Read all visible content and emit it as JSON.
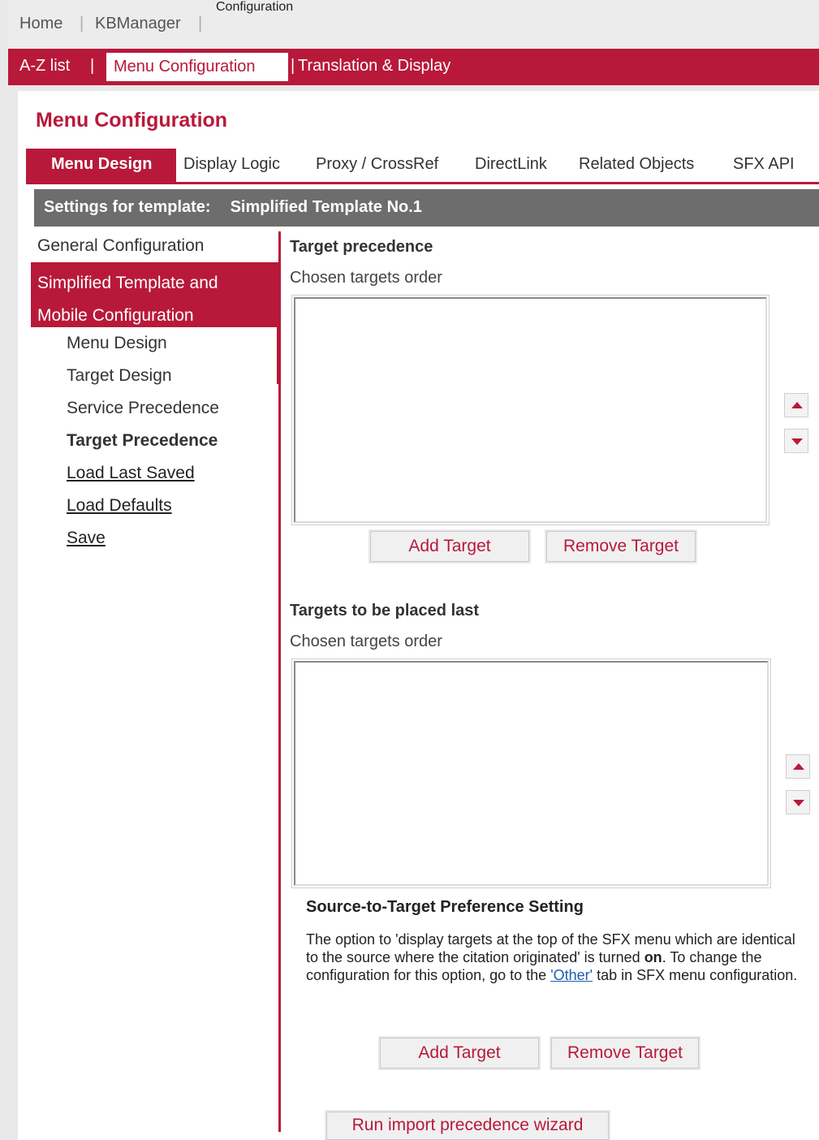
{
  "topnav": {
    "home": "Home",
    "kbmanager": "KBManager",
    "configuration": "Configuration"
  },
  "subnav": {
    "az_list": "A-Z list",
    "menu_configuration": "Menu Configuration",
    "translation_display": "Translation & Display"
  },
  "page_title": "Menu Configuration",
  "tabs": [
    {
      "label": "Menu Design"
    },
    {
      "label": "Display Logic"
    },
    {
      "label": "Proxy / CrossRef"
    },
    {
      "label": "DirectLink"
    },
    {
      "label": "Related Objects"
    },
    {
      "label": "SFX API"
    }
  ],
  "settings_bar": {
    "label": "Settings for template:",
    "value": "Simplified Template No.1"
  },
  "sidebar": {
    "general": "General Configuration",
    "active_line1": "Simplified Template and",
    "active_line2": "Mobile Configuration",
    "items": [
      {
        "label": "Menu Design"
      },
      {
        "label": "Target Design"
      },
      {
        "label": "Service Precedence"
      },
      {
        "label": "Target Precedence"
      },
      {
        "label": "Load Last Saved"
      },
      {
        "label": "Load Defaults"
      },
      {
        "label": "Save"
      }
    ]
  },
  "target_precedence": {
    "title": "Target precedence",
    "subtitle": "Chosen targets order",
    "add_label": "Add Target",
    "remove_label": "Remove Target"
  },
  "targets_last": {
    "title": "Targets to be placed last",
    "subtitle": "Chosen targets order",
    "add_label": "Add Target",
    "remove_label": "Remove Target"
  },
  "preference": {
    "title": "Source-to-Target Preference Setting",
    "text_1": "The option to 'display targets at the top of the SFX menu which are identical to the source where the citation originated' is turned ",
    "text_on": "on",
    "text_2": ". To change the configuration for this option, go to the ",
    "link": "'Other'",
    "text_3": " tab in SFX menu configuration."
  },
  "wizard_button": "Run import precedence wizard",
  "colors": {
    "accent": "#b8193a",
    "bar": "#6d6d6d"
  }
}
